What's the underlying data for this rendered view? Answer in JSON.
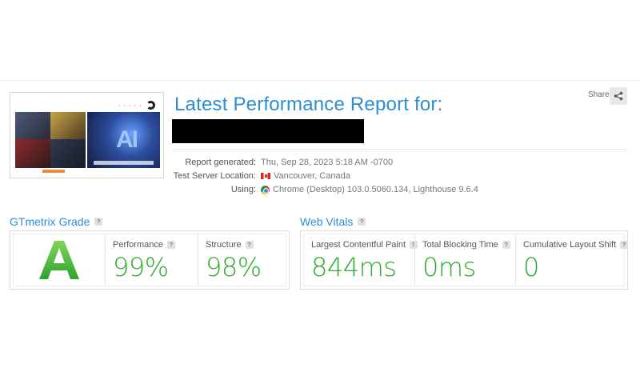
{
  "report": {
    "title": "Latest Performance Report for:",
    "share_label": "Share",
    "meta": [
      {
        "key": "Report generated:",
        "value": "Thu, Sep 28, 2023 5:18 AM -0700",
        "icon": ""
      },
      {
        "key": "Test Server Location:",
        "value": "Vancouver, Canada",
        "icon": "canada-flag-icon"
      },
      {
        "key": "Using:",
        "value": "Chrome (Desktop) 103.0.5060.134, Lighthouse 9.6.4",
        "icon": "chrome-icon"
      }
    ]
  },
  "grade": {
    "section_title": "GTmetrix Grade",
    "letter": "A",
    "letter_color": "#3cb043",
    "performance": {
      "label": "Performance",
      "value": "99%"
    },
    "structure": {
      "label": "Structure",
      "value": "98%"
    }
  },
  "vitals": {
    "section_title": "Web Vitals",
    "lcp": {
      "label": "Largest Contentful Paint",
      "value": "844ms"
    },
    "tbt": {
      "label": "Total Blocking Time",
      "value": "0ms"
    },
    "cls": {
      "label": "Cumulative Layout Shift",
      "value": "0"
    }
  },
  "help_glyph": "?",
  "colors": {
    "accent": "#2b8dd6",
    "good": "#2fac2f"
  }
}
